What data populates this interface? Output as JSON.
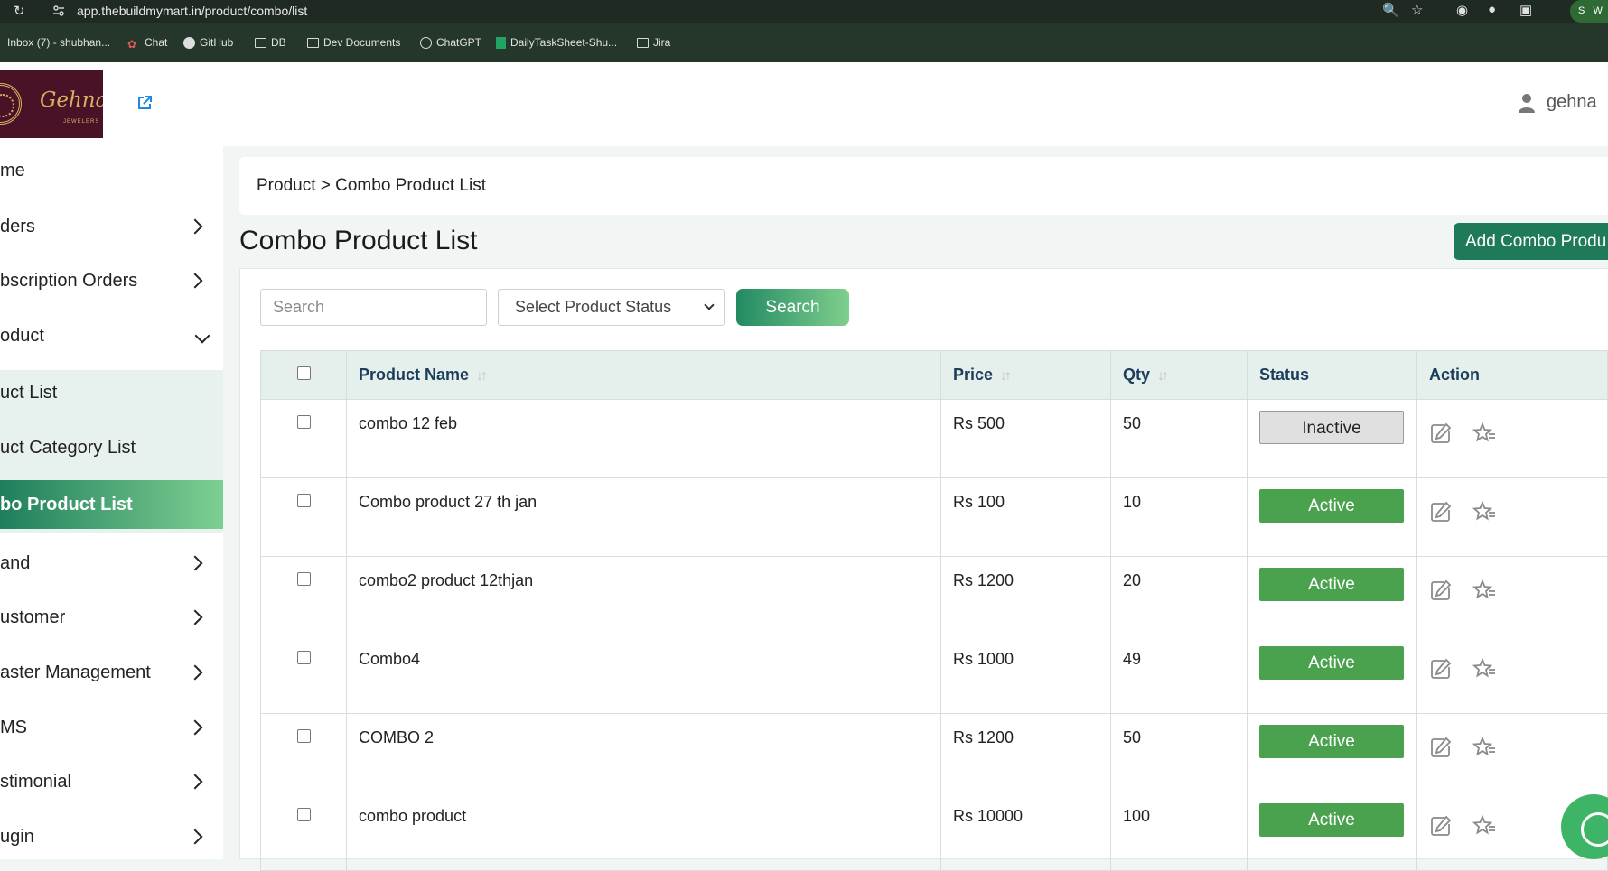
{
  "browser": {
    "url": "app.thebuildmymart.in/product/combo/list",
    "profile_initial": "S",
    "profile_extra": "W"
  },
  "bookmarks": [
    {
      "label": "Inbox (7) - shubhan..."
    },
    {
      "label": "Chat"
    },
    {
      "label": "GitHub"
    },
    {
      "label": "DB"
    },
    {
      "label": "Dev Documents"
    },
    {
      "label": "ChatGPT"
    },
    {
      "label": "DailyTaskSheet-Shu..."
    },
    {
      "label": "Jira"
    }
  ],
  "header": {
    "brand": "Gehna",
    "brand_sub": "JEWELERS",
    "username": "gehna"
  },
  "sidebar": {
    "items": [
      {
        "label": "me"
      },
      {
        "label": "ders"
      },
      {
        "label": "bscription Orders"
      },
      {
        "label": "oduct"
      },
      {
        "label": "uct List"
      },
      {
        "label": "uct Category List"
      },
      {
        "label": "bo Product List"
      },
      {
        "label": "and"
      },
      {
        "label": "ustomer"
      },
      {
        "label": "aster Management"
      },
      {
        "label": "MS"
      },
      {
        "label": "stimonial"
      },
      {
        "label": "ugin"
      }
    ]
  },
  "main": {
    "breadcrumb": "Product > Combo Product List",
    "title": "Combo Product List",
    "add_button": "Add Combo Produ",
    "search_placeholder": "Search",
    "status_select": "Select Product Status",
    "search_button": "Search"
  },
  "table": {
    "headers": {
      "name": "Product Name",
      "price": "Price",
      "qty": "Qty",
      "status": "Status",
      "action": "Action"
    },
    "rows": [
      {
        "name": "combo 12 feb",
        "price": "Rs 500",
        "qty": "50",
        "status": "Inactive"
      },
      {
        "name": "Combo product 27 th jan",
        "price": "Rs 100",
        "qty": "10",
        "status": "Active"
      },
      {
        "name": "combo2 product 12thjan",
        "price": "Rs 1200",
        "qty": "20",
        "status": "Active"
      },
      {
        "name": "Combo4",
        "price": "Rs 1000",
        "qty": "49",
        "status": "Active"
      },
      {
        "name": "COMBO 2",
        "price": "Rs 1200",
        "qty": "50",
        "status": "Active"
      },
      {
        "name": "combo product",
        "price": "Rs 10000",
        "qty": "100",
        "status": "Active"
      }
    ]
  },
  "colors": {
    "primary": "#1f7a5a",
    "active_badge": "#4aa24e",
    "header_bg": "#e5f0ec"
  }
}
